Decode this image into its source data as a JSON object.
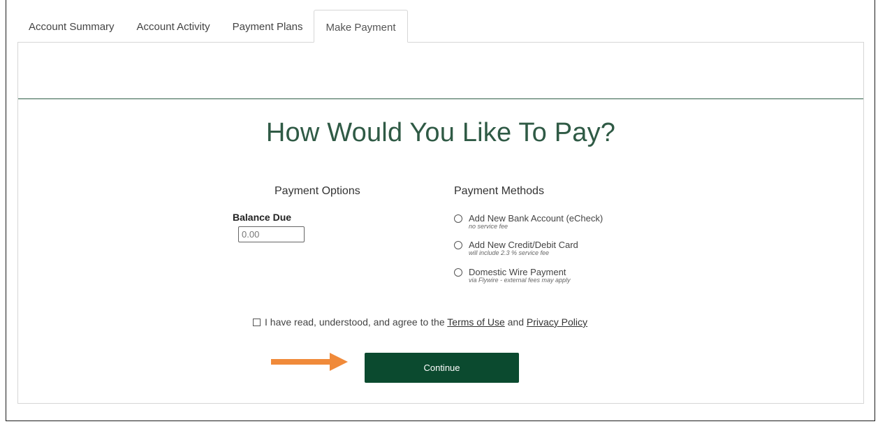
{
  "tabs": [
    {
      "label": "Account Summary"
    },
    {
      "label": "Account Activity"
    },
    {
      "label": "Payment Plans"
    },
    {
      "label": "Make Payment"
    }
  ],
  "heading": "How Would You Like To Pay?",
  "payment_options": {
    "title": "Payment Options",
    "balance_label": "Balance Due",
    "balance_value": "0.00"
  },
  "payment_methods": {
    "title": "Payment Methods",
    "items": [
      {
        "label": "Add New Bank Account (eCheck)",
        "note": "no service fee"
      },
      {
        "label": "Add New Credit/Debit Card",
        "note": "will include 2.3 % service fee"
      },
      {
        "label": "Domestic Wire Payment",
        "note": "via Flywire - external fees may apply"
      }
    ]
  },
  "agreement": {
    "prefix": "I have read, understood, and agree to the ",
    "terms_link": "Terms of Use",
    "middle": " and ",
    "privacy_link": "Privacy Policy"
  },
  "continue_label": "Continue",
  "colors": {
    "accent": "#0b4a2f",
    "heading": "#2f5a45",
    "arrow": "#f08a3a"
  },
  "icons": [
    "arrow-right-icon"
  ]
}
